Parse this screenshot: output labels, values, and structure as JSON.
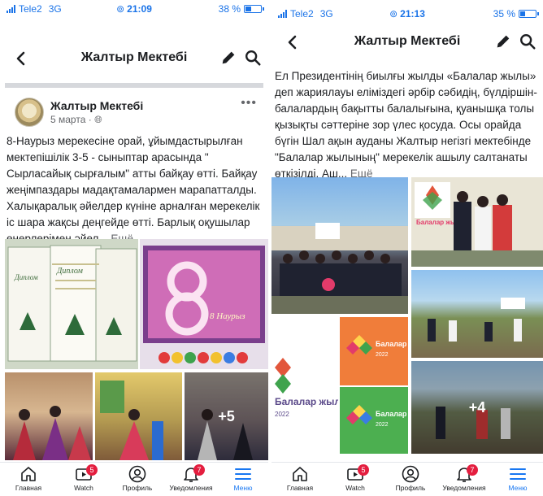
{
  "left": {
    "status": {
      "carrier": "Tele2",
      "network": "3G",
      "time": "21:09",
      "battery": "38 %",
      "battery_level": 0.38
    },
    "header": {
      "title": "Жалтыр Мектебі"
    },
    "post": {
      "author": "Жалтыр Мектебі",
      "date": "5 марта ·",
      "more_dots": "•••",
      "text": "8-Наурыз мерекесіне орай, ұйымдастырылған мектепішілік 3-5 - сыныптар арасында \" Сырласайық сырғалым\" атты байқау өтті. Байқау жеңімпаздары мадақтамалармен марапатталды. Халықаралық әйелдер күніне арналған мерекелік іс шара жақсы деңгейде өтті. Барлық оқушылар өнерлерімен әйел...",
      "see_more": "Ещё",
      "photos": {
        "diploma_label": "Диплом",
        "nauryz_label": "8 Наурыз",
        "more_count": "+5"
      }
    },
    "nav": {
      "items": [
        {
          "label": "Главная"
        },
        {
          "label": "Watch",
          "badge": "5"
        },
        {
          "label": "Профиль"
        },
        {
          "label": "Уведомления",
          "badge": "7"
        },
        {
          "label": "Меню"
        }
      ]
    }
  },
  "right": {
    "status": {
      "carrier": "Tele2",
      "network": "3G",
      "time": "21:13",
      "battery": "35 %",
      "battery_level": 0.35
    },
    "header": {
      "title": "Жалтыр Мектебі"
    },
    "post": {
      "text": "Ел Президентінің биылғы жылды «Балалар жылы» деп жариялауы еліміздегі әрбір сәбидің, бүлдіршін-балалардың бақытты балалығына, қуанышқа толы қызықты сәттеріне зор үлес қосуда. Осы орайда бүгін Шал ақын ауданы Жалтыр негізгі мектебінде  \"Балалар жылының\" мерекелік ашылу салтанаты өткізілді. Аш...",
      "see_more": "Ещё",
      "photos": {
        "logo_title": "Балалар жылы",
        "logo_year": "2022",
        "more_count": "+4"
      }
    },
    "nav": {
      "items": [
        {
          "label": "Главная"
        },
        {
          "label": "Watch",
          "badge": "5"
        },
        {
          "label": "Профиль"
        },
        {
          "label": "Уведомления",
          "badge": "7"
        },
        {
          "label": "Меню"
        }
      ]
    }
  },
  "colors": {
    "accent": "#1877f2",
    "badge": "#e41e3f",
    "status_blue": "#1a73e8"
  },
  "icons": [
    "back-arrow-icon",
    "edit-pencil-icon",
    "search-icon",
    "globe-icon",
    "home-icon",
    "watch-icon",
    "profile-icon",
    "bell-icon",
    "menu-icon"
  ]
}
